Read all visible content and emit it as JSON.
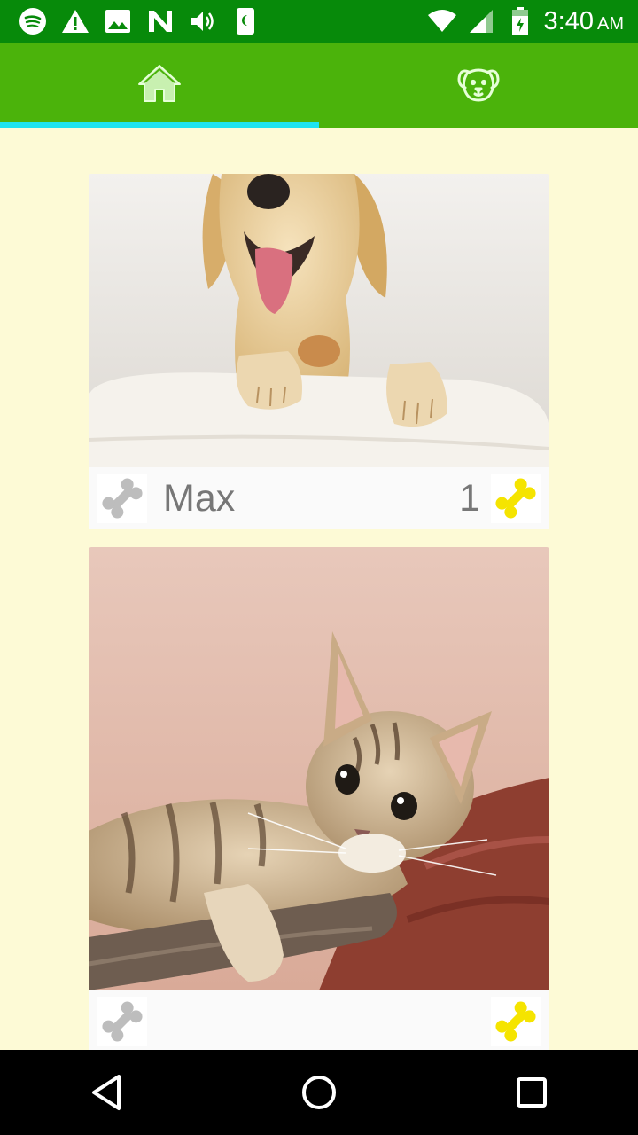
{
  "status_bar": {
    "time": "3:40",
    "ampm": "AM",
    "left_icons": [
      "spotify-icon",
      "warning-icon",
      "image-icon",
      "n-notification-icon",
      "volume-icon",
      "phone-moon-icon"
    ],
    "right_icons": [
      "wifi-icon",
      "signal-icon",
      "battery-charging-icon"
    ]
  },
  "tabs": [
    {
      "name": "home",
      "icon": "home-icon",
      "selected": true
    },
    {
      "name": "pets",
      "icon": "dog-face-icon",
      "selected": false
    }
  ],
  "colors": {
    "status_bar": "#078a0a",
    "tab_bar": "#4bb30b",
    "tab_indicator": "#1ee4f0",
    "background": "#fdfad6",
    "bone_grey": "#bdbdbd",
    "bone_yellow": "#f5e400"
  },
  "pets": [
    {
      "name": "Max",
      "likes": "1",
      "photo": "golden-retriever-puppy"
    },
    {
      "name": "",
      "likes": "",
      "photo": "tabby-kitten"
    }
  ],
  "nav": [
    "back-button",
    "home-button",
    "recents-button"
  ]
}
